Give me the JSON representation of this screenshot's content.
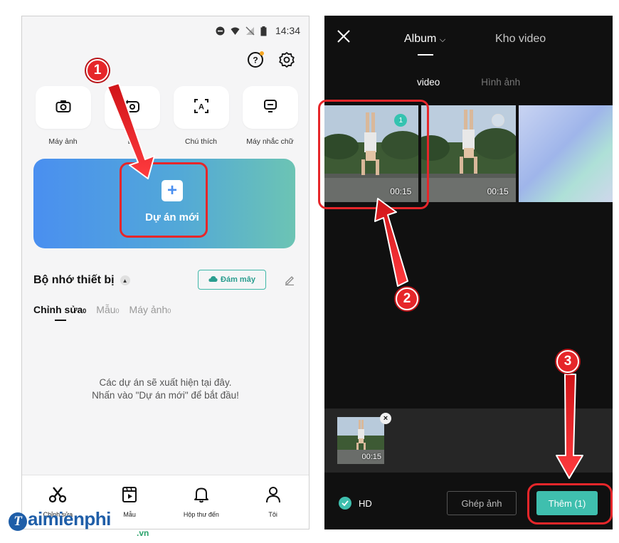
{
  "left_screen": {
    "status": {
      "time": "14:34"
    },
    "tools": [
      {
        "label": "Máy ảnh",
        "icon": "camera-icon"
      },
      {
        "label": "Là",
        "icon": "retouch-camera-icon"
      },
      {
        "label": "Chú thích",
        "icon": "auto-caption-icon"
      },
      {
        "label": "Máy nhắc chữ",
        "icon": "teleprompter-icon"
      }
    ],
    "new_project": {
      "label": "Dự án mới"
    },
    "storage": {
      "title": "Bộ nhớ thiết bị",
      "cloud_label": "Đám mây"
    },
    "tabs": [
      {
        "label": "Chỉnh sửa",
        "count": "0"
      },
      {
        "label": "Mẫu",
        "count": "0"
      },
      {
        "label": "Máy ảnh",
        "count": "0"
      }
    ],
    "empty_state": {
      "line1": "Các dự án sẽ xuất hiện tại đây.",
      "line2": "Nhấn vào \"Dự án mới\" để bắt đầu!"
    },
    "bottom_nav": [
      {
        "label": "Chỉnh sửa",
        "icon": "scissors-icon"
      },
      {
        "label": "Mẫu",
        "icon": "template-icon"
      },
      {
        "label": "Hộp thư đến",
        "icon": "bell-icon"
      },
      {
        "label": "Tôi",
        "icon": "profile-icon"
      }
    ]
  },
  "right_screen": {
    "tabs": {
      "album": "Album",
      "library": "Kho video"
    },
    "sub_tabs": {
      "video": "video",
      "photos": "Hình ảnh"
    },
    "thumbnails": [
      {
        "duration": "00:15",
        "selected_index": "1"
      },
      {
        "duration": "00:15"
      }
    ],
    "selected_clip": {
      "duration": "00:15"
    },
    "hd_label": "HD",
    "merge_button": "Ghép ảnh",
    "add_button": "Thêm (1)"
  },
  "steps": [
    "1",
    "2",
    "3"
  ],
  "watermark": {
    "letter": "T",
    "name": "aimienphi",
    "tld": ".vn"
  },
  "colors": {
    "accent": "#3fbfae",
    "highlight": "#e6262a",
    "brand": "#1f5ea8"
  }
}
